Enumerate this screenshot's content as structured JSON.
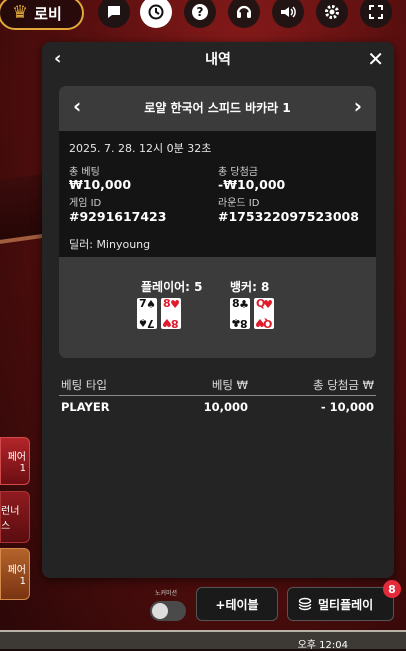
{
  "topbar": {
    "lobby_label": "로비",
    "icons": [
      "chat-icon",
      "history-icon",
      "help-icon",
      "support-icon",
      "sound-icon",
      "settings-icon",
      "fullscreen-icon"
    ]
  },
  "side_bets": {
    "item1": "페어",
    "item1_sub": "1",
    "item2": "런너스",
    "item3": "페어",
    "item3_sub": "1"
  },
  "panel": {
    "title": "내역",
    "game_name": "로얄 한국어 스피드 바카라 1",
    "datetime": "2025. 7. 28. 12시 0분 32초",
    "total_bet_label": "총 베팅",
    "total_bet_value": "₩10,000",
    "total_win_label": "총 당첨금",
    "total_win_value": "-₩10,000",
    "game_id_label": "게임 ID",
    "game_id_value": "#9291617423",
    "round_id_label": "라운드 ID",
    "round_id_value": "#175322097523008",
    "dealer_line": "딜러: Minyoung",
    "player_score": "플레이어: 5",
    "banker_score": "뱅커: 8",
    "player_cards": [
      {
        "rank": "7",
        "suit": "♠",
        "color": "#111111"
      },
      {
        "rank": "8",
        "suit": "♥",
        "color": "#e01c2c"
      }
    ],
    "banker_cards": [
      {
        "rank": "8",
        "suit": "♣",
        "color": "#111111"
      },
      {
        "rank": "Q",
        "suit": "♥",
        "color": "#e01c2c"
      }
    ],
    "table_headers": [
      "베팅 타입",
      "베팅 ₩",
      "총 당첨금 ₩"
    ],
    "table_rows": [
      {
        "type": "PLAYER",
        "bet": "10,000",
        "win": "- 10,000"
      }
    ]
  },
  "bottom": {
    "no_commission_label": "노커미션",
    "add_table_label": "+테이블",
    "multiplay_label": "멀티플레이",
    "multiplay_badge": "8"
  },
  "taskbar": {
    "clock": "오후 12:04"
  },
  "colors": {
    "accent_gold": "#e2a93a",
    "badge_red": "#e42b3a",
    "panel_bg": "#242424"
  }
}
